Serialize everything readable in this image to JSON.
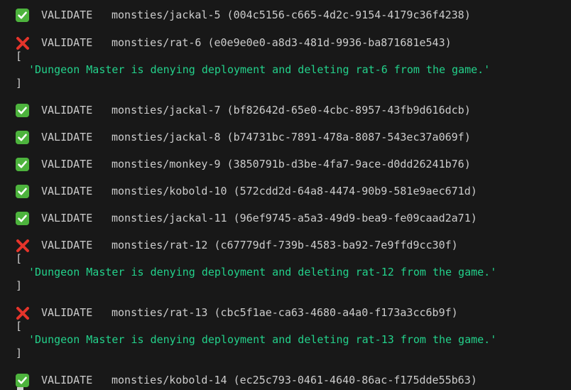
{
  "colors": {
    "background": "#181818",
    "text": "#cccccc",
    "message": "#23d18b",
    "success": "#4db33d",
    "error": "#e5342b"
  },
  "entries": [
    {
      "status": "success",
      "icon": "check-mark-icon",
      "verb": "VALIDATE",
      "target": "monsties/jackal-5 (004c5156-c665-4d2c-9154-4179c36f4238)"
    },
    {
      "status": "error",
      "icon": "cross-mark-icon",
      "verb": "VALIDATE",
      "target": "monsties/rat-6 (e0e9e0e0-a8d3-481d-9936-ba871681e543)",
      "open_bracket": "[",
      "message": "'Dungeon Master is denying deployment and deleting rat-6 from the game.'",
      "close_bracket": "]"
    },
    {
      "status": "success",
      "icon": "check-mark-icon",
      "verb": "VALIDATE",
      "target": "monsties/jackal-7 (bf82642d-65e0-4cbc-8957-43fb9d616dcb)"
    },
    {
      "status": "success",
      "icon": "check-mark-icon",
      "verb": "VALIDATE",
      "target": "monsties/jackal-8 (b74731bc-7891-478a-8087-543ec37a069f)"
    },
    {
      "status": "success",
      "icon": "check-mark-icon",
      "verb": "VALIDATE",
      "target": "monsties/monkey-9 (3850791b-d3be-4fa7-9ace-d0dd26241b76)"
    },
    {
      "status": "success",
      "icon": "check-mark-icon",
      "verb": "VALIDATE",
      "target": "monsties/kobold-10 (572cdd2d-64a8-4474-90b9-581e9aec671d)"
    },
    {
      "status": "success",
      "icon": "check-mark-icon",
      "verb": "VALIDATE",
      "target": "monsties/jackal-11 (96ef9745-a5a3-49d9-bea9-fe09caad2a71)"
    },
    {
      "status": "error",
      "icon": "cross-mark-icon",
      "verb": "VALIDATE",
      "target": "monsties/rat-12 (c67779df-739b-4583-ba92-7e9ffd9cc30f)",
      "open_bracket": "[",
      "message": "'Dungeon Master is denying deployment and deleting rat-12 from the game.'",
      "close_bracket": "]"
    },
    {
      "status": "error",
      "icon": "cross-mark-icon",
      "verb": "VALIDATE",
      "target": "monsties/rat-13 (cbc5f1ae-ca63-4680-a4a0-f173a3cc6b9f)",
      "open_bracket": "[",
      "message": "'Dungeon Master is denying deployment and deleting rat-13 from the game.'",
      "close_bracket": "]"
    },
    {
      "status": "success",
      "icon": "check-mark-icon",
      "verb": "VALIDATE",
      "target": "monsties/kobold-14 (ec25c793-0461-4640-86ac-f175dde55b63)"
    }
  ]
}
